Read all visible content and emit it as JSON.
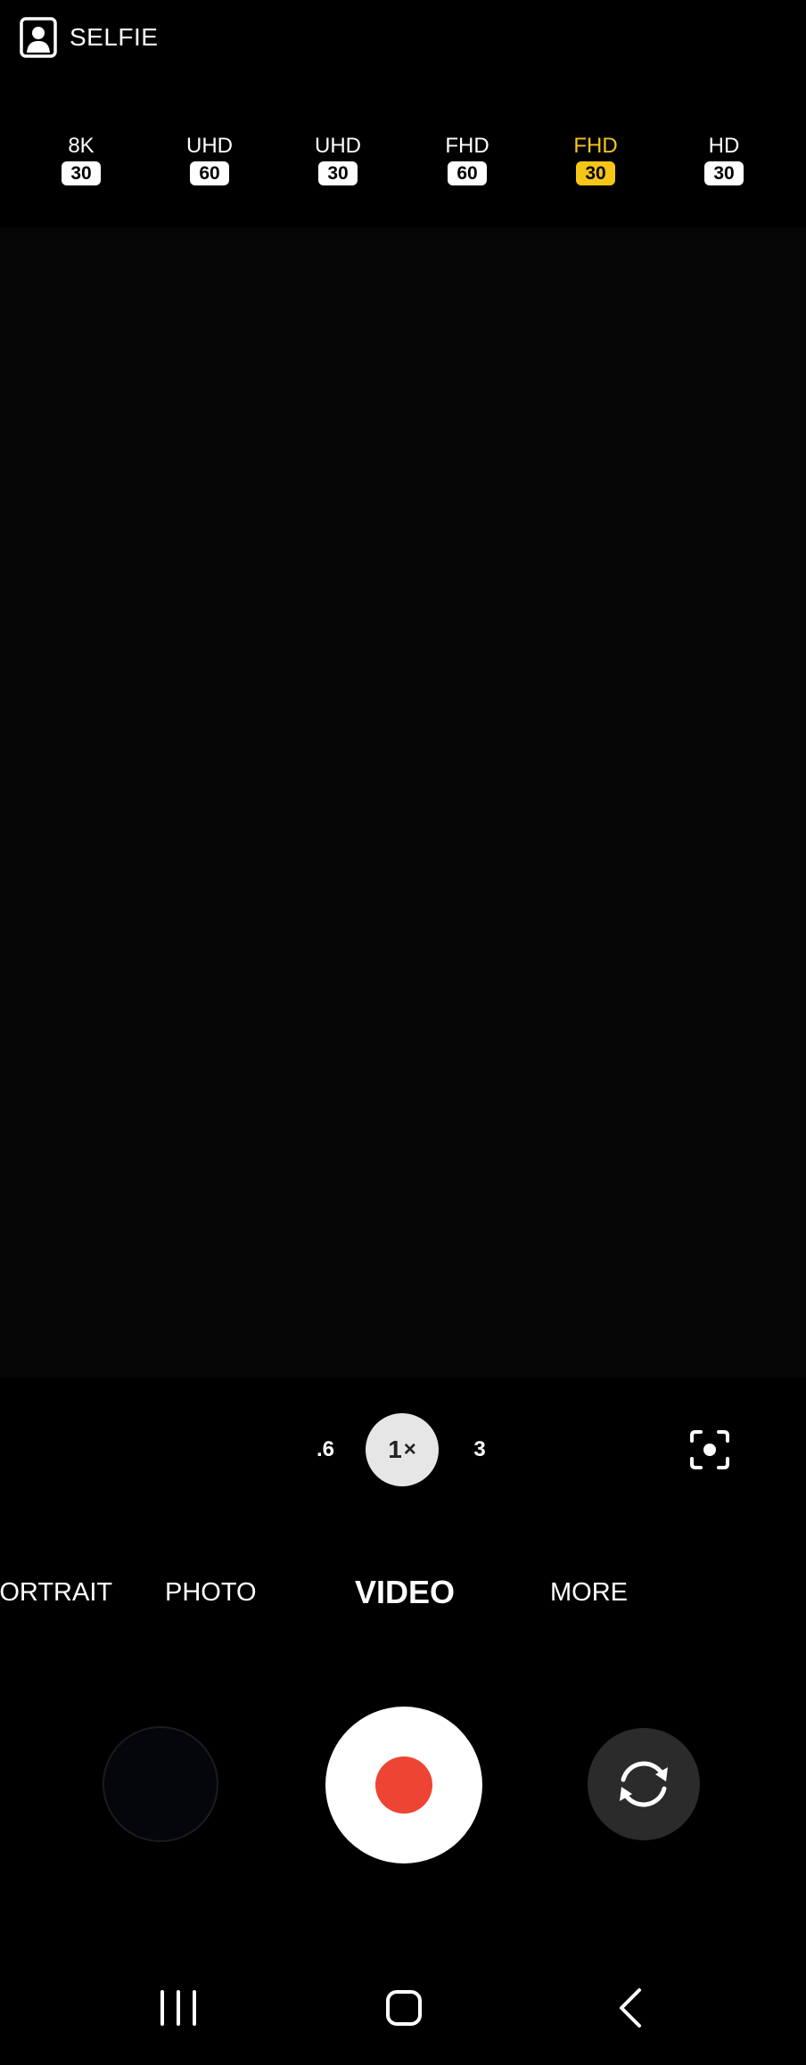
{
  "top_bar": {
    "camera_label": "SELFIE",
    "camera_icon": "selfie-icon"
  },
  "resolution_options": [
    {
      "name": "8K",
      "fps": "30",
      "selected": false
    },
    {
      "name": "UHD",
      "fps": "60",
      "selected": false
    },
    {
      "name": "UHD",
      "fps": "30",
      "selected": false
    },
    {
      "name": "FHD",
      "fps": "60",
      "selected": false
    },
    {
      "name": "FHD",
      "fps": "30",
      "selected": true
    },
    {
      "name": "HD",
      "fps": "30",
      "selected": false
    }
  ],
  "zoom": {
    "options": [
      ".6",
      "1",
      "3"
    ],
    "active_suffix": "×",
    "active_index": 1
  },
  "modes": {
    "items": [
      "PORTRAIT",
      "PHOTO",
      "VIDEO",
      "MORE"
    ],
    "active": "VIDEO"
  },
  "icons": {
    "focus": "focus-frame-icon",
    "record": "record-icon",
    "switch_camera": "switch-camera-icon",
    "recent_apps": "recent-apps-icon",
    "home": "home-icon",
    "back": "back-icon"
  },
  "colors": {
    "selected_resolution": "#f5c518",
    "record_dot": "#ee4433",
    "zoom_active_bg": "#e6e6e6",
    "switch_bg": "#2b2b2b"
  }
}
